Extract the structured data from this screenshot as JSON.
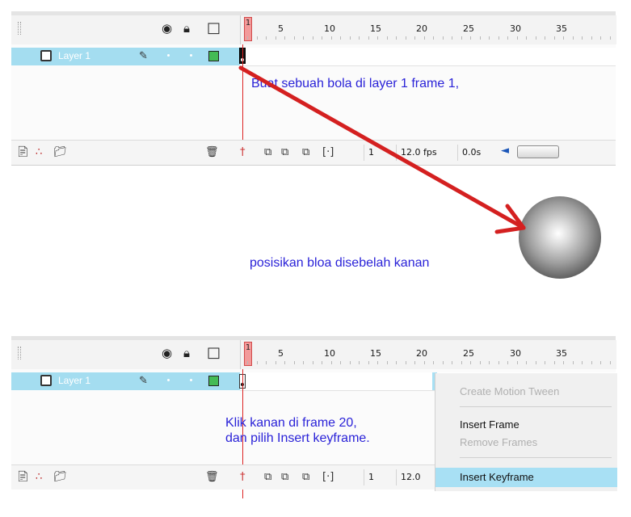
{
  "panel1": {
    "layer_name": "Layer 1",
    "ruler_numbers": [
      "1",
      "5",
      "10",
      "15",
      "20",
      "25",
      "30",
      "35"
    ],
    "note_top": "Buat sebuah bola di layer 1 frame 1,",
    "note_bottom": "posisikan bloa disebelah kanan",
    "status": {
      "frame": "1",
      "fps": "12.0 fps",
      "time": "0.0s"
    }
  },
  "panel2": {
    "layer_name": "Layer 1",
    "ruler_numbers": [
      "1",
      "5",
      "10",
      "15",
      "20",
      "25",
      "30",
      "35"
    ],
    "note_line1": "Klik kanan di frame 20,",
    "note_line2": "dan pilih Insert keyframe.",
    "status": {
      "frame": "1",
      "fps": "12.0"
    },
    "context_menu": {
      "items": [
        {
          "label": "Create Motion Tween",
          "state": "disabled"
        },
        {
          "label": "Insert Frame",
          "state": "enabled"
        },
        {
          "label": "Remove Frames",
          "state": "disabled"
        },
        {
          "label": "Insert Keyframe",
          "state": "highlighted"
        }
      ]
    }
  },
  "colors": {
    "annotation_text": "#2a22d8",
    "arrow": "#d42020",
    "layer_highlight": "#a4ddf0",
    "playhead": "#f29a9a"
  },
  "icons": [
    "eye-icon",
    "lock-icon",
    "outline-icon",
    "layer-page-icon",
    "pencil-icon",
    "add-layer-icon",
    "add-motion-guide-icon",
    "insert-folder-icon",
    "trash-icon",
    "center-frame-icon",
    "onion-skin-icon",
    "onion-skin-outline-icon",
    "edit-multiple-frames-icon",
    "modify-markers-icon"
  ]
}
